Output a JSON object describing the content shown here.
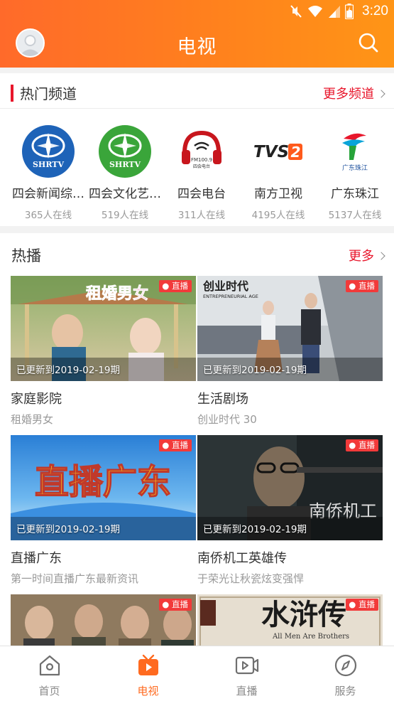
{
  "status_bar": {
    "time": "3:20"
  },
  "header": {
    "title": "电视"
  },
  "hot_channels": {
    "title": "热门频道",
    "more_label": "更多频道",
    "items": [
      {
        "name": "四会新闻综…",
        "online": "365人在线",
        "logo_text": "SHRTV",
        "icon": "shrtv-blue-logo"
      },
      {
        "name": "四会文化艺…",
        "online": "519人在线",
        "logo_text": "SHRTV",
        "icon": "shrtv-green-logo"
      },
      {
        "name": "四会电台",
        "online": "311人在线",
        "logo_text": "FM100.9",
        "logo_subtext": "四会电台",
        "icon": "radio-headphone-logo"
      },
      {
        "name": "南方卫视",
        "online": "4195人在线",
        "logo_text": "TVS2",
        "icon": "tvs2-logo"
      },
      {
        "name": "广东珠江",
        "online": "5137人在线",
        "logo_text": "广东珠江",
        "icon": "zhujiang-logo"
      }
    ]
  },
  "hot_play": {
    "title": "热播",
    "more_label": "更多",
    "live_label": "直播",
    "items": [
      {
        "title": "家庭影院",
        "subtitle": "租婚男女",
        "update": "已更新到2019-02-19期",
        "poster_text": "租婚男女"
      },
      {
        "title": "生活剧场",
        "subtitle": "创业时代 30",
        "update": "已更新到2019-02-19期",
        "poster_text": "创业时代",
        "poster_subtext": "ENTREPRENEURIAL AGE"
      },
      {
        "title": "直播广东",
        "subtitle": "第一时间直播广东最新资讯",
        "update": "已更新到2019-02-19期",
        "poster_text": "直播广东"
      },
      {
        "title": "南侨机工英雄传",
        "subtitle": "于荣光让秋瓷炫变强悍",
        "update": "已更新到2019-02-19期",
        "poster_text": "南侨机工"
      },
      {
        "title": "",
        "subtitle": "",
        "update": "",
        "poster_text": ""
      },
      {
        "title": "",
        "subtitle": "",
        "update": "",
        "poster_text": "水浒传",
        "poster_subtext": "All Men Are Brothers"
      }
    ]
  },
  "bottom_nav": {
    "items": [
      {
        "label": "首页",
        "icon": "home-icon"
      },
      {
        "label": "电视",
        "icon": "tv-icon",
        "active": true
      },
      {
        "label": "直播",
        "icon": "live-video-icon"
      },
      {
        "label": "服务",
        "icon": "compass-icon"
      }
    ]
  },
  "colors": {
    "accent": "#ff6a1f",
    "header_gradient_start": "#ff6a2a",
    "header_gradient_end": "#ff9516",
    "red": "#e8162b",
    "live_badge": "#f23a3a"
  }
}
